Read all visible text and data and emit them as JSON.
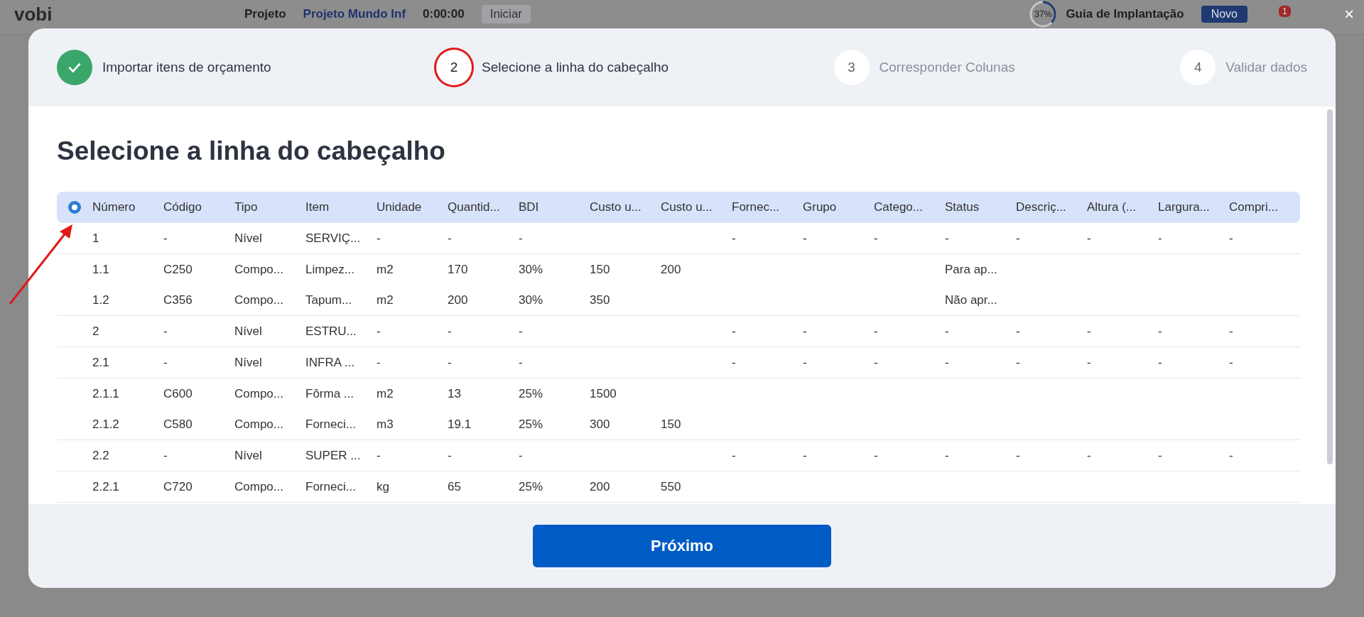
{
  "background": {
    "logo": "vobi",
    "project_label": "Projeto",
    "project_name": "Projeto Mundo Inf",
    "timer": "0:00:00",
    "start_button": "Iniciar",
    "guide": {
      "progress": "37%",
      "level": 0.37,
      "label": "Guia de Implantação"
    },
    "new_button": "Novo",
    "notification_count": "1",
    "close": "×"
  },
  "steps": [
    {
      "label": "Importar itens de orçamento",
      "completed": true,
      "current": false
    },
    {
      "number": "2",
      "label": "Selecione a linha do cabeçalho",
      "completed": false,
      "current": true
    },
    {
      "number": "3",
      "label": "Corresponder Colunas",
      "completed": false,
      "current": false
    },
    {
      "number": "4",
      "label": "Validar dados",
      "completed": false,
      "current": false
    }
  ],
  "title": "Selecione a linha do cabeçalho",
  "table": {
    "header_selected": true,
    "columns": [
      "Número",
      "Código",
      "Tipo",
      "Item",
      "Unidade",
      "Quantid...",
      "BDI",
      "Custo u...",
      "Custo u...",
      "Fornec...",
      "Grupo",
      "Catego...",
      "Status",
      "Descriç...",
      "Altura (...",
      "Largura...",
      "Compri..."
    ],
    "row_groups": [
      {
        "rows": [
          [
            "1",
            "-",
            "Nível",
            "SERVIÇ...",
            "-",
            "-",
            "-",
            null,
            null,
            "-",
            "-",
            "-",
            "-",
            "-",
            "-",
            "-",
            "-"
          ]
        ]
      },
      {
        "rows": [
          [
            "1.1",
            "C250",
            "Compo...",
            "Limpez...",
            "m2",
            "170",
            "30%",
            "150",
            "200",
            null,
            null,
            null,
            "Para ap...",
            null,
            null,
            null,
            null
          ],
          [
            "1.2",
            "C356",
            "Compo...",
            "Tapum...",
            "m2",
            "200",
            "30%",
            "350",
            null,
            null,
            null,
            null,
            "Não apr...",
            null,
            null,
            null,
            null
          ]
        ]
      },
      {
        "rows": [
          [
            "2",
            "-",
            "Nível",
            "ESTRU...",
            "-",
            "-",
            "-",
            null,
            null,
            "-",
            "-",
            "-",
            "-",
            "-",
            "-",
            "-",
            "-"
          ]
        ]
      },
      {
        "rows": [
          [
            "2.1",
            "-",
            "Nível",
            "INFRA ...",
            "-",
            "-",
            "-",
            null,
            null,
            "-",
            "-",
            "-",
            "-",
            "-",
            "-",
            "-",
            "-"
          ]
        ]
      },
      {
        "rows": [
          [
            "2.1.1",
            "C600",
            "Compo...",
            "Fôrma ...",
            "m2",
            "13",
            "25%",
            "1500",
            null,
            null,
            null,
            null,
            null,
            null,
            null,
            null,
            null
          ],
          [
            "2.1.2",
            "C580",
            "Compo...",
            "Forneci...",
            "m3",
            "19.1",
            "25%",
            "300",
            "150",
            null,
            null,
            null,
            null,
            null,
            null,
            null,
            null
          ]
        ]
      },
      {
        "rows": [
          [
            "2.2",
            "-",
            "Nível",
            "SUPER ...",
            "-",
            "-",
            "-",
            null,
            null,
            "-",
            "-",
            "-",
            "-",
            "-",
            "-",
            "-",
            "-"
          ]
        ]
      },
      {
        "rows": [
          [
            "2.2.1",
            "C720",
            "Compo...",
            "Forneci...",
            "kg",
            "65",
            "25%",
            "200",
            "550",
            null,
            null,
            null,
            null,
            null,
            null,
            null,
            null
          ]
        ]
      }
    ]
  },
  "next_button": "Próximo"
}
